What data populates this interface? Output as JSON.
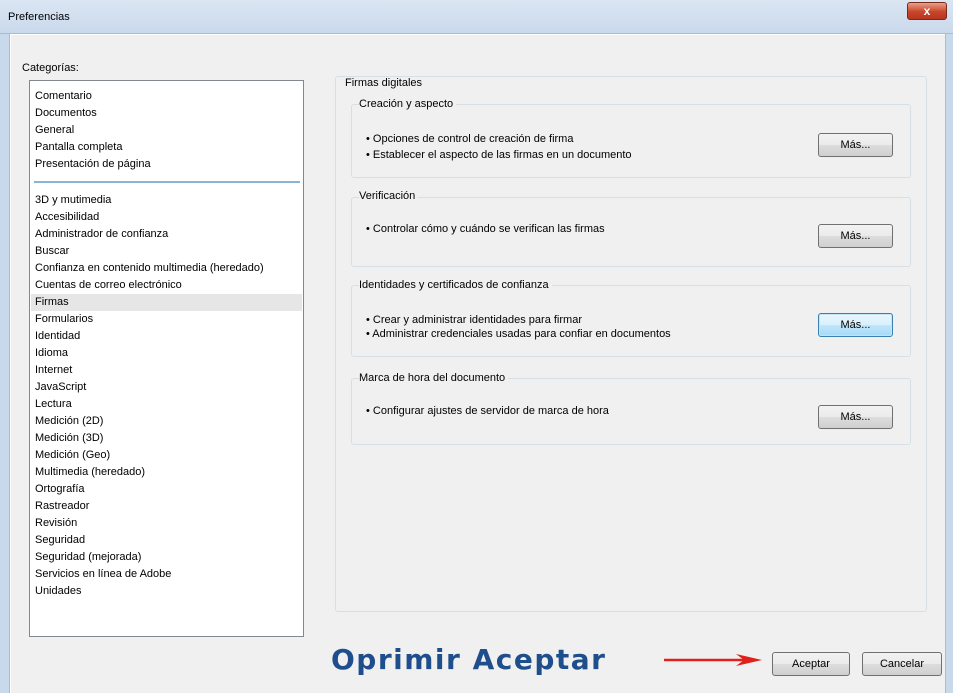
{
  "window": {
    "title": "Preferencias",
    "close_glyph": "x"
  },
  "categories": {
    "label": "Categorías:",
    "top_items": [
      "Comentario",
      "Documentos",
      "General",
      "Pantalla completa",
      "Presentación de página"
    ],
    "items": [
      "3D y mutimedia",
      "Accesibilidad",
      "Administrador de confianza",
      "Buscar",
      "Confianza en contenido multimedia (heredado)",
      "Cuentas de correo electrónico",
      "Firmas",
      "Formularios",
      "Identidad",
      "Idioma",
      "Internet",
      "JavaScript",
      "Lectura",
      "Medición (2D)",
      "Medición (3D)",
      "Medición (Geo)",
      "Multimedia (heredado)",
      "Ortografía",
      "Rastreador",
      "Revisión",
      "Seguridad",
      "Seguridad (mejorada)",
      "Servicios en línea de Adobe",
      "Unidades"
    ],
    "selected": "Firmas"
  },
  "panel": {
    "title": "Firmas digitales",
    "groups": [
      {
        "title": "Creación y aspecto",
        "bullets": [
          "• Opciones de control de creación de firma",
          "• Establecer el aspecto de las firmas en un documento"
        ],
        "button": "Más..."
      },
      {
        "title": "Verificación",
        "bullets": [
          "• Controlar cómo y cuándo se verifican las firmas"
        ],
        "button": "Más..."
      },
      {
        "title": "Identidades y certificados de confianza",
        "bullets": [
          "• Crear y administrar identidades para firmar",
          "• Administrar credenciales usadas para confiar en documentos"
        ],
        "button": "Más..."
      },
      {
        "title": "Marca de hora del documento",
        "bullets": [
          "• Configurar ajustes de servidor de marca de hora"
        ],
        "button": "Más..."
      }
    ]
  },
  "footer": {
    "annotation": "Oprimir Aceptar",
    "ok_label": "Aceptar",
    "cancel_label": "Cancelar"
  },
  "colors": {
    "annotation": "#1f4e8c",
    "arrow": "#e0201a",
    "selection": "#e6e6e6"
  }
}
